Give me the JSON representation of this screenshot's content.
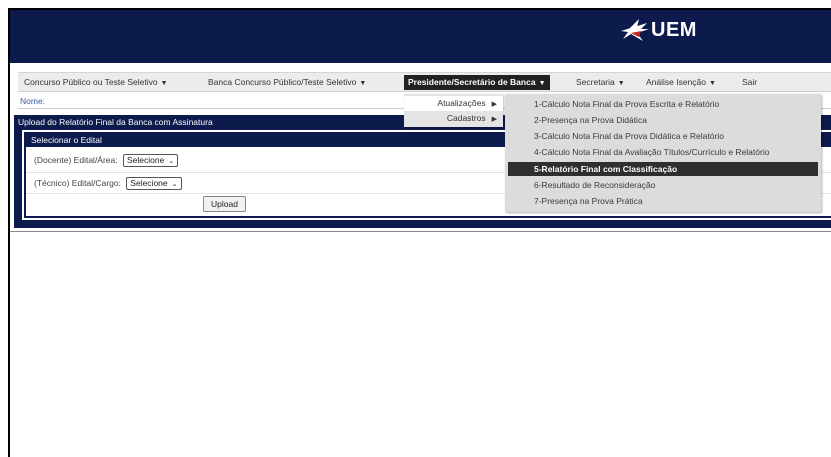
{
  "header": {
    "logo_text": "UEM",
    "colors": {
      "header_bg": "#0c1a4c",
      "active_bg": "#2f2f2f"
    }
  },
  "nav": {
    "items": [
      {
        "label": "Concurso Público ou Teste Seletivo",
        "icon": "caret-down-icon"
      },
      {
        "label": "Banca Concurso Público/Teste Seletivo",
        "icon": "caret-down-icon"
      },
      {
        "label": "Presidente/Secretário de Banca",
        "icon": "caret-down-icon",
        "active": true
      },
      {
        "label": "Secretaria",
        "icon": "caret-down-icon"
      },
      {
        "label": "Análise Isenção",
        "icon": "caret-down-icon"
      },
      {
        "label": "Sair"
      }
    ]
  },
  "nome": {
    "label": "Nome:"
  },
  "panel": {
    "title": "Upload do Relatório Final da Banca com Assinatura",
    "section_title": "Selecionar o Edital",
    "docente_label": "(Docente) Edital/Área:",
    "docente_select": "Selecione",
    "tecnico_label": "(Técnico) Edital/Cargo:",
    "tecnico_select": "Selecione",
    "upload_label": "Upload"
  },
  "submenu_level1": {
    "items": [
      {
        "label": "Atualizações",
        "icon": "caret-right-icon",
        "active": true
      },
      {
        "label": "Cadastros",
        "icon": "caret-right-icon"
      }
    ]
  },
  "submenu_level2": {
    "items": [
      {
        "label": "1-Cálculo Nota Final da Prova Escrita e Relatório"
      },
      {
        "label": "2-Presença na Prova Didática"
      },
      {
        "label": "3-Cálculo Nota Final da Prova Didática e Relatório"
      },
      {
        "label": "4-Cálculo Nota Final da Avaliação Títulos/Currículo e Relatório"
      },
      {
        "label": "5-Relatório Final com Classificação",
        "selected": true
      },
      {
        "label": "6-Resultado de Reconsideração"
      },
      {
        "label": "7-Presença na Prova Prática"
      }
    ]
  }
}
